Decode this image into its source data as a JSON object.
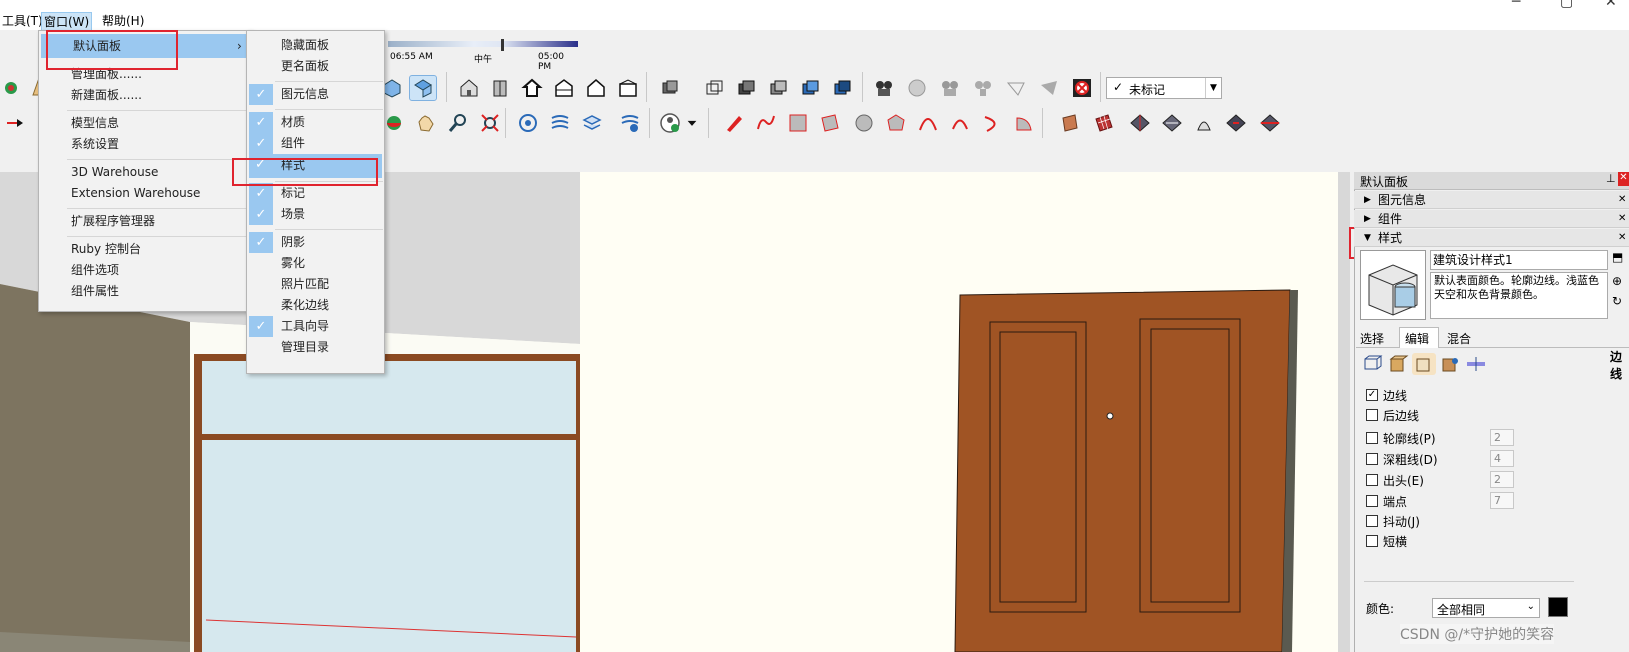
{
  "menubar": {
    "items": [
      "工具(T)",
      "窗口(W)",
      "帮助(H)"
    ]
  },
  "timeline": {
    "start": "06:55 AM",
    "noon": "中午",
    "end": "05:00 PM"
  },
  "tag_dropdown": {
    "value": "未标记"
  },
  "window_menu": {
    "items": [
      {
        "label": "默认面板",
        "submenu": true
      },
      {
        "label": "管理面板......"
      },
      {
        "label": "新建面板......"
      },
      {
        "label": "模型信息"
      },
      {
        "label": "系统设置"
      },
      {
        "label": "3D Warehouse"
      },
      {
        "label": "Extension Warehouse"
      },
      {
        "label": "扩展程序管理器"
      },
      {
        "label": "Ruby 控制台"
      },
      {
        "label": "组件选项"
      },
      {
        "label": "组件属性"
      }
    ]
  },
  "panel_menu": {
    "items": [
      {
        "label": "隐藏面板",
        "checked": false
      },
      {
        "label": "更名面板",
        "checked": false
      },
      {
        "label": "图元信息",
        "checked": true
      },
      {
        "label": "材质",
        "checked": true
      },
      {
        "label": "组件",
        "checked": true
      },
      {
        "label": "样式",
        "checked": true
      },
      {
        "label": "标记",
        "checked": true
      },
      {
        "label": "场景",
        "checked": true
      },
      {
        "label": "阴影",
        "checked": true
      },
      {
        "label": "雾化",
        "checked": false
      },
      {
        "label": "照片匹配",
        "checked": false
      },
      {
        "label": "柔化边线",
        "checked": false
      },
      {
        "label": "工具向导",
        "checked": true
      },
      {
        "label": "管理目录",
        "checked": false
      }
    ]
  },
  "tray": {
    "title": "默认面板",
    "sections": [
      "图元信息",
      "组件",
      "样式"
    ],
    "style_name": "建筑设计样式1",
    "style_desc": "默认表面颜色。轮廓边线。浅蓝色天空和灰色背景颜色。",
    "tabs": [
      "选择",
      "编辑",
      "混合"
    ],
    "edge_label": "边线",
    "edge_settings": [
      {
        "label": "边线",
        "checked": true,
        "value": ""
      },
      {
        "label": "后边线",
        "checked": false,
        "value": ""
      },
      {
        "label": "轮廓线(P)",
        "checked": false,
        "value": "2"
      },
      {
        "label": "深粗线(D)",
        "checked": false,
        "value": "4"
      },
      {
        "label": "出头(E)",
        "checked": false,
        "value": "2"
      },
      {
        "label": "端点",
        "checked": false,
        "value": "7"
      },
      {
        "label": "抖动(J)",
        "checked": false,
        "value": ""
      },
      {
        "label": "短横",
        "checked": false,
        "value": ""
      }
    ],
    "color_label": "颜色:",
    "color_value": "全部相同"
  },
  "watermark": "CSDN @/*守护她的笑容",
  "colors": {
    "highlight": "#9ac8f0",
    "redbox": "#e0242f",
    "wood": "#9a4e22"
  }
}
